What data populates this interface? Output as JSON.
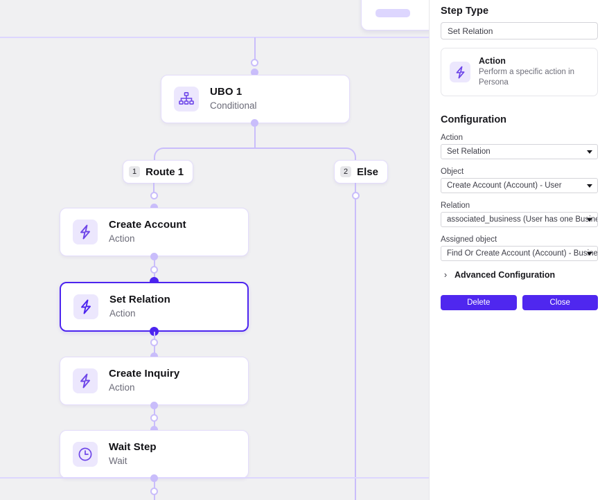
{
  "canvas": {
    "nodes": [
      {
        "id": "ubo1",
        "title": "UBO 1",
        "subtitle": "Conditional",
        "icon": "hierarchy-icon",
        "selected": false
      },
      {
        "id": "create-account",
        "title": "Create Account",
        "subtitle": "Action",
        "icon": "lightning-icon",
        "selected": false
      },
      {
        "id": "set-relation",
        "title": "Set Relation",
        "subtitle": "Action",
        "icon": "lightning-icon",
        "selected": true
      },
      {
        "id": "create-inquiry",
        "title": "Create Inquiry",
        "subtitle": "Action",
        "icon": "lightning-icon",
        "selected": false
      },
      {
        "id": "wait-step",
        "title": "Wait Step",
        "subtitle": "Wait",
        "icon": "clock-icon",
        "selected": false
      }
    ],
    "routes": [
      {
        "id": "route-1",
        "number": "1",
        "label": "Route 1"
      },
      {
        "id": "else",
        "number": "2",
        "label": "Else"
      }
    ],
    "colors": {
      "background": "#f0f0f2",
      "connector": "#c9bdfb",
      "connector_light": "#ddd6fe",
      "selected": "#4c24ef"
    }
  },
  "panel": {
    "step_type": {
      "heading": "Step Type",
      "value": "Set Relation",
      "card": {
        "name": "Action",
        "description": "Perform a specific action in Persona",
        "icon": "lightning-icon"
      }
    },
    "configuration": {
      "heading": "Configuration",
      "fields": [
        {
          "id": "action",
          "label": "Action",
          "value": "Set Relation"
        },
        {
          "id": "object",
          "label": "Object",
          "value": "Create Account (Account) - User"
        },
        {
          "id": "relation",
          "label": "Relation",
          "value": "associated_business (User has one Business)"
        },
        {
          "id": "assigned-object",
          "label": "Assigned object",
          "value": "Find Or Create Account (Account) - Business"
        }
      ],
      "advanced": {
        "label": "Advanced Configuration",
        "chevron": "›",
        "expanded": false
      },
      "buttons": [
        {
          "id": "delete",
          "label": "Delete"
        },
        {
          "id": "close",
          "label": "Close"
        }
      ],
      "accent_color": "#4f27ef"
    }
  }
}
